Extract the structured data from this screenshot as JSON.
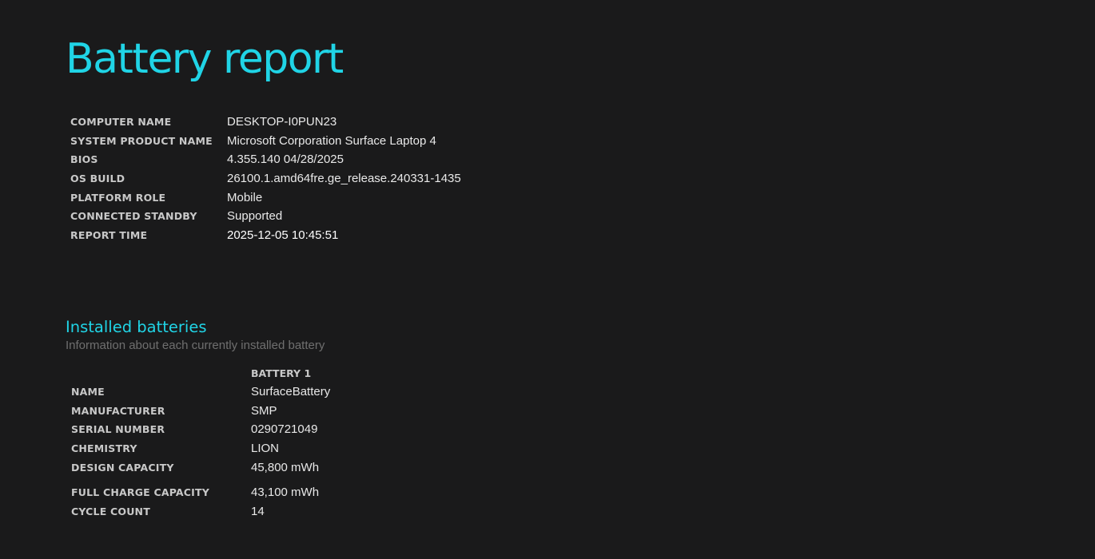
{
  "header": {
    "title": "Battery report"
  },
  "system_info": {
    "rows": [
      {
        "label": "COMPUTER NAME",
        "value": "DESKTOP-I0PUN23"
      },
      {
        "label": "SYSTEM PRODUCT NAME",
        "value": "Microsoft Corporation Surface Laptop 4"
      },
      {
        "label": "BIOS",
        "value": "4.355.140 04/28/2025"
      },
      {
        "label": "OS BUILD",
        "value": "26100.1.amd64fre.ge_release.240331-1435"
      },
      {
        "label": "PLATFORM ROLE",
        "value": "Mobile"
      },
      {
        "label": "CONNECTED STANDBY",
        "value": "Supported"
      },
      {
        "label": "REPORT TIME",
        "value": "2025-12-05  10:45:51"
      }
    ]
  },
  "installed_batteries": {
    "title": "Installed batteries",
    "subtitle": "Information about each currently installed battery",
    "column_header": "BATTERY 1",
    "rows": [
      {
        "label": "NAME",
        "value": "SurfaceBattery"
      },
      {
        "label": "MANUFACTURER",
        "value": "SMP"
      },
      {
        "label": "SERIAL NUMBER",
        "value": "0290721049"
      },
      {
        "label": "CHEMISTRY",
        "value": "LION"
      },
      {
        "label": "DESIGN CAPACITY",
        "value": "45,800 mWh"
      },
      {
        "label": "FULL CHARGE CAPACITY",
        "value": "43,100 mWh"
      },
      {
        "label": "CYCLE COUNT",
        "value": "14"
      }
    ]
  }
}
